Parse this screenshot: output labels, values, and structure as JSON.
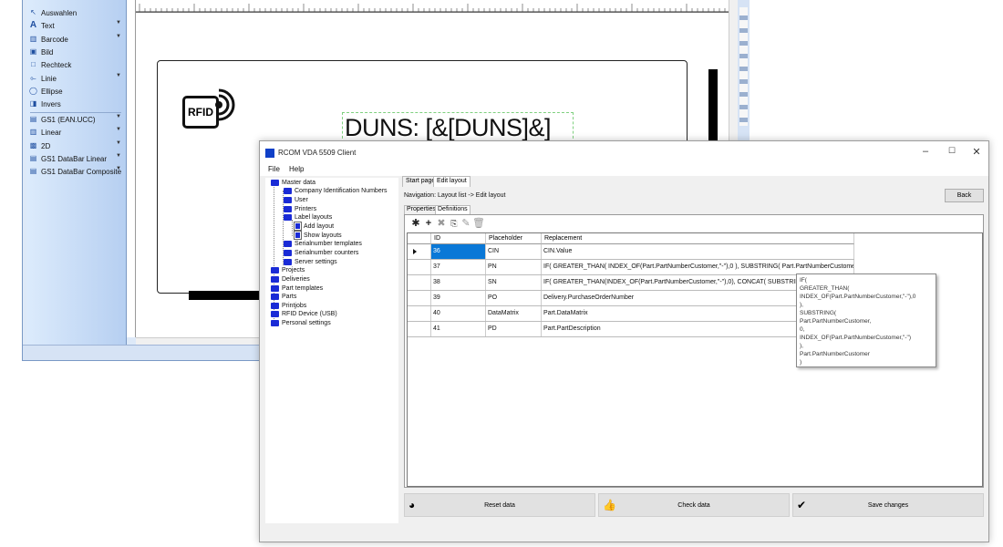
{
  "designer": {
    "toolbox": {
      "items": [
        {
          "label": "Auswahlen",
          "icon": "cursor-icon"
        },
        {
          "label": "Text",
          "icon": "text-icon"
        },
        {
          "label": "Barcode",
          "icon": "barcode-icon"
        },
        {
          "label": "Bild",
          "icon": "image-icon"
        },
        {
          "label": "Rechteck",
          "icon": "rectangle-icon"
        },
        {
          "label": "Linie",
          "icon": "line-icon"
        },
        {
          "label": "Ellipse",
          "icon": "ellipse-icon"
        },
        {
          "label": "Invers",
          "icon": "invert-icon"
        },
        {
          "label": "GS1 (EAN.UCC)",
          "icon": "gs1-icon"
        },
        {
          "label": "Linear",
          "icon": "linear-barcode-icon"
        },
        {
          "label": "2D",
          "icon": "2d-barcode-icon"
        },
        {
          "label": "GS1 DataBar Linear",
          "icon": "gs1-databar-icon"
        },
        {
          "label": "GS1 DataBar Composite",
          "icon": "gs1-composite-icon"
        }
      ]
    },
    "label": {
      "rfid_text": "RFID",
      "duns_text": "DUNS: [&[DUNS]&]"
    },
    "scroll_arrow": "<"
  },
  "client": {
    "title": "RCOM VDA 5509 Client",
    "controls": {
      "minimize": "–",
      "maximize": "☐",
      "close": "✕"
    },
    "menu": [
      "File",
      "Help"
    ],
    "tree": [
      "Master data",
      "Company Identification Numbers",
      "User",
      "Printers",
      "Label layouts",
      "Add layout",
      "Show layouts",
      "Serialnumber templates",
      "Serialnumber counters",
      "Server settings",
      "Projects",
      "Deliveries",
      "Part templates",
      "Parts",
      "Printjobs",
      "RFID Device (USB)",
      "Personal settings"
    ],
    "tabs": [
      "Start page",
      "Edit layout"
    ],
    "navigation": "Navigation:  Layout list -> Edit layout",
    "back_label": "Back",
    "subtabs": [
      "Properties",
      "Definitions"
    ],
    "grid": {
      "headers": [
        "ID",
        "Placeholder",
        "Replacement"
      ],
      "rows": [
        {
          "id": "36",
          "placeholder": "CIN",
          "replacement": "CIN.Value"
        },
        {
          "id": "37",
          "placeholder": "PN",
          "replacement": "IF( GREATER_THAN(   INDEX_OF(Part.PartNumberCustomer,\"-\"),0 ),  SUBSTRING(   Part.PartNumberCustomer,..."
        },
        {
          "id": "38",
          "placeholder": "SN",
          "replacement": "IF( GREATER_THAN(INDEX_OF(Part.PartNumberCustomer,\"-\"),0),  CONCAT(   SUBSTRING("
        },
        {
          "id": "39",
          "placeholder": "PO",
          "replacement": "Delivery.PurchaseOrderNumber"
        },
        {
          "id": "40",
          "placeholder": "DataMatrix",
          "replacement": "Part.DataMatrix"
        },
        {
          "id": "41",
          "placeholder": "PD",
          "replacement": "Part.PartDescription"
        }
      ]
    },
    "tooltip": [
      "IF(",
      "  GREATER_THAN(",
      "   INDEX_OF(Part.PartNumberCustomer,\"-\"),0",
      "  ),",
      "  SUBSTRING(",
      "   Part.PartNumberCustomer,",
      "   0,",
      "   INDEX_OF(Part.PartNumberCustomer,\"-\")",
      "  ),",
      "  Part.PartNumberCustomer",
      ")"
    ],
    "actions": {
      "reset": "Reset data",
      "check": "Check data",
      "save": "Save changes"
    },
    "selected_color": "#0a78d7"
  }
}
